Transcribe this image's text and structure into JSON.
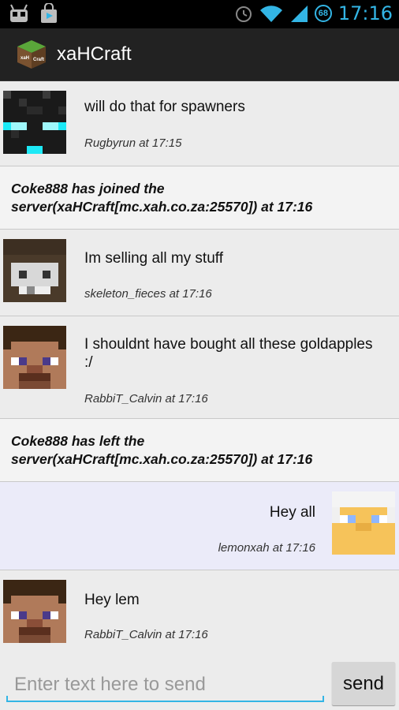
{
  "status_bar": {
    "time": "17:16",
    "battery_level": "68",
    "notification_icons": [
      "android-icon",
      "shopping-bag-icon"
    ],
    "system_icons": [
      "alarm-icon",
      "wifi-icon",
      "signal-icon",
      "battery-icon"
    ]
  },
  "action_bar": {
    "title": "xaHCraft",
    "logo_text": "xaH Craft"
  },
  "messages": [
    {
      "type": "other",
      "text": "will do that for spawners",
      "author": "Rugbyrun",
      "time": "17:15",
      "meta": "Rugbyrun at 17:15",
      "avatar": "enderman"
    },
    {
      "type": "system",
      "text": "Coke888 has joined the server(xaHCraft[mc.xah.co.za:25570]) at 17:16"
    },
    {
      "type": "other",
      "text": "Im selling all my stuff",
      "author": "skeleton_fieces",
      "time": "17:16",
      "meta": "skeleton_fieces at 17:16",
      "avatar": "skull"
    },
    {
      "type": "other",
      "text": "I shouldnt have bought all these goldapples :/",
      "author": "RabbiT_Calvin",
      "time": "17:16",
      "meta": "RabbiT_Calvin at 17:16",
      "avatar": "steve"
    },
    {
      "type": "system",
      "text": "Coke888 has left the server(xaHCraft[mc.xah.co.za:25570]) at 17:16"
    },
    {
      "type": "self",
      "text": "Hey all",
      "author": "lemonxah",
      "time": "17:16",
      "meta": "lemonxah at 17:16",
      "avatar": "yellow"
    },
    {
      "type": "other",
      "text": "Hey lem",
      "author": "RabbiT_Calvin",
      "time": "17:16",
      "meta": "RabbiT_Calvin at 17:16",
      "avatar": "steve"
    }
  ],
  "composer": {
    "value": "",
    "placeholder": "Enter text here to send",
    "send_label": "send"
  },
  "colors": {
    "accent": "#33b5e5",
    "action_bar": "#222222",
    "self_bubble": "#ebebf9"
  }
}
